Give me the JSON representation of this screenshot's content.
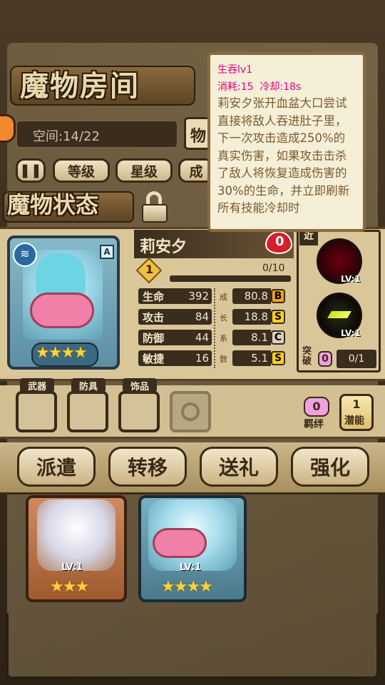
{
  "header": {
    "title": "魔物房间",
    "space_label": "空间:14/22",
    "tab_partial": "物"
  },
  "sort_buttons": [
    "等级",
    "星级",
    "成"
  ],
  "section_title": "魔物状态",
  "skill_popup": {
    "name": "生吞lv1",
    "cost_line": "消耗:15  冷却:18s",
    "description": "莉安夕张开血盆大口尝试直接将敌人吞进肚子里，下一次攻击造成250%的真实伤害，如果攻击击杀了敌人将恢复造成伤害的30%的生命，并立即刷新所有技能冷却时"
  },
  "monster": {
    "name": "莉安夕",
    "rank_letter": "A",
    "stars": "★★★★",
    "level_badge": "1",
    "exp": "0/10",
    "heart_count": "0",
    "stats": [
      {
        "label": "生命",
        "value": "392",
        "growth": "80.8",
        "grade": "B",
        "grade_color": "#f0a020"
      },
      {
        "label": "攻击",
        "value": "84",
        "growth": "18.8",
        "grade": "S",
        "grade_color": "#ffd020"
      },
      {
        "label": "防御",
        "value": "44",
        "growth": "8.1",
        "grade": "C",
        "grade_color": "#d8d0c0"
      },
      {
        "label": "敏捷",
        "value": "16",
        "growth": "5.1",
        "grade": "S",
        "grade_color": "#ffd020"
      }
    ],
    "growth_chars": [
      "成",
      "长",
      "系",
      "数"
    ]
  },
  "skills_panel": {
    "range_tag": "近",
    "skill1_level": "LV:1",
    "skill2_level": "LV:1",
    "breakthrough_label": "突破",
    "breakthrough_badge": "0",
    "breakthrough_progress": "0/1"
  },
  "equipment": {
    "weapon": "武器",
    "armor": "防具",
    "accessory": "饰品"
  },
  "side_buttons": {
    "bond_count": "0",
    "bond_label": "羁绊",
    "potential_count": "1",
    "potential_label": "潜能"
  },
  "actions": [
    "派遣",
    "转移",
    "送礼",
    "强化"
  ],
  "cards": [
    {
      "level": "LV:1",
      "stars": "★★★"
    },
    {
      "level": "LV:1",
      "stars": "★★★★"
    }
  ]
}
